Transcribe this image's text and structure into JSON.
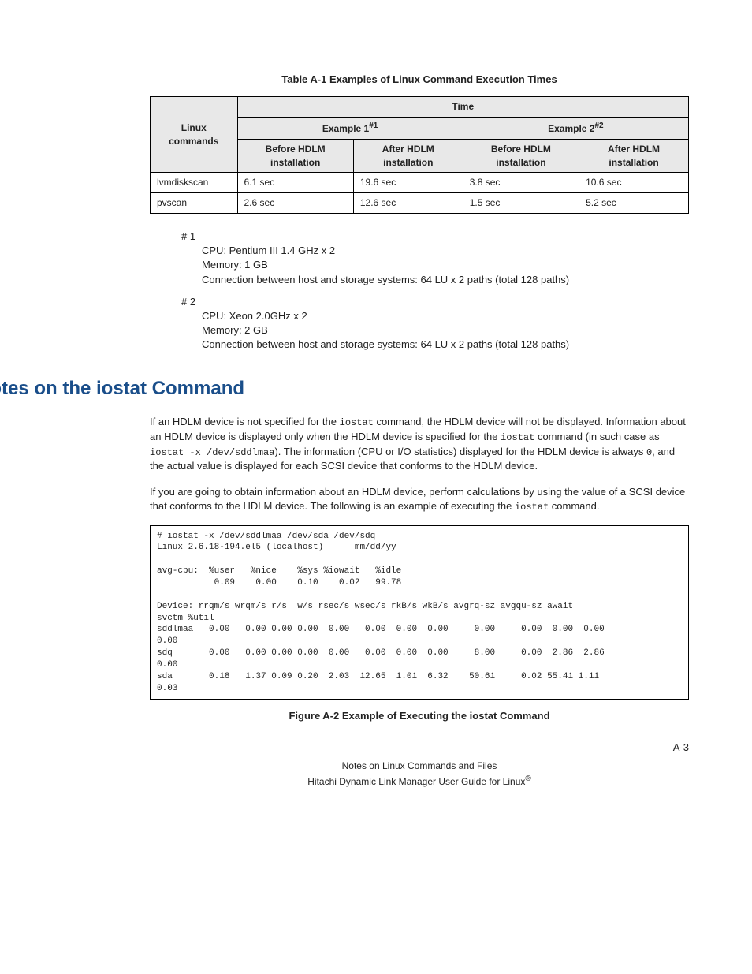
{
  "table": {
    "caption": "Table A-1 Examples of Linux Command Execution Times",
    "head": {
      "rowlabel": "Linux commands",
      "time": "Time",
      "ex1": "Example 1",
      "ex1_sup": "#1",
      "ex2": "Example 2",
      "ex2_sup": "#2",
      "before": "Before HDLM installation",
      "after": "After HDLM installation"
    },
    "rows": [
      {
        "cmd": "lvmdiskscan",
        "e1b": "6.1 sec",
        "e1a": "19.6 sec",
        "e2b": "3.8 sec",
        "e2a": "10.6 sec"
      },
      {
        "cmd": "pvscan",
        "e1b": "2.6 sec",
        "e1a": "12.6 sec",
        "e2b": "1.5 sec",
        "e2a": "5.2 sec"
      }
    ]
  },
  "notes": {
    "n1": {
      "tag": "# 1",
      "cpu": "CPU: Pentium III 1.4 GHz x 2",
      "mem": "Memory: 1 GB",
      "conn": "Connection between host and storage systems: 64 LU x 2 paths (total 128 paths)"
    },
    "n2": {
      "tag": "# 2",
      "cpu": "CPU: Xeon 2.0GHz x 2",
      "mem": "Memory: 2 GB",
      "conn": "Connection between host and storage systems: 64 LU x 2 paths (total 128 paths)"
    }
  },
  "section": {
    "title": "Notes on the iostat Command",
    "para1_a": "If an HDLM device is not specified for the ",
    "para1_code1": "iostat",
    "para1_b": " command, the HDLM device will not be displayed. Information about an HDLM device is displayed only when the HDLM device is specified for the ",
    "para1_code2": "iostat",
    "para1_c": " command (in such case as ",
    "para1_code3": "iostat -x /dev/sddlmaa",
    "para1_d": "). The information (CPU or I/O statistics) displayed for the HDLM device is always ",
    "para1_code4": "0",
    "para1_e": ", and the actual value is displayed for each SCSI device that conforms to the HDLM device.",
    "para2_a": "If you are going to obtain information about an HDLM device, perform calculations by using the value of a SCSI device that conforms to the HDLM device. The following is an example of executing the ",
    "para2_code1": "iostat",
    "para2_b": " command."
  },
  "console": "# iostat -x /dev/sddlmaa /dev/sda /dev/sdq\nLinux 2.6.18-194.el5 (localhost)      mm/dd/yy\n\navg-cpu:  %user   %nice    %sys %iowait   %idle\n           0.09    0.00    0.10    0.02   99.78\n\nDevice: rrqm/s wrqm/s r/s  w/s rsec/s wsec/s rkB/s wkB/s avgrq-sz avgqu-sz await\nsvctm %util\nsddlmaa   0.00   0.00 0.00 0.00  0.00   0.00  0.00  0.00     0.00     0.00  0.00  0.00\n0.00\nsdq       0.00   0.00 0.00 0.00  0.00   0.00  0.00  0.00     8.00     0.00  2.86  2.86\n0.00\nsda       0.18   1.37 0.09 0.20  2.03  12.65  1.01  6.32    50.61     0.02 55.41 1.11\n0.03",
  "figure_caption": "Figure A-2 Example of Executing the iostat Command",
  "footer": {
    "left": "Notes on Linux Commands and Files",
    "page": "A-3",
    "sub_a": "Hitachi Dynamic Link Manager User Guide for Linux",
    "sub_sup": "®"
  }
}
